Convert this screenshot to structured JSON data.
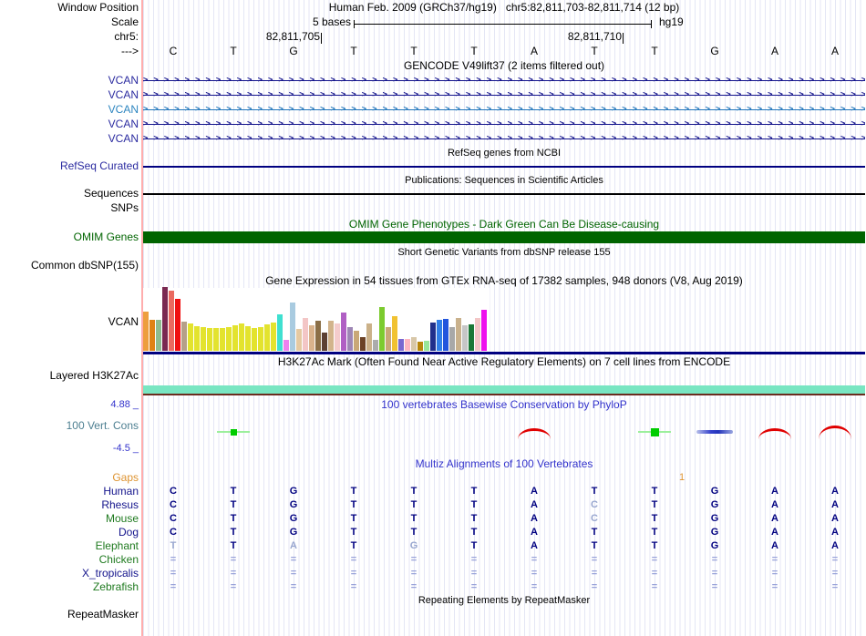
{
  "header": {
    "window_position_label": "Window Position",
    "assembly": "Human Feb. 2009 (GRCh37/hg19)",
    "position": "chr5:82,811,703-82,811,714 (12 bp)",
    "scale_label": "Scale",
    "scale_value": "5 bases",
    "scale_assembly": "hg19",
    "chrom_label": "chr5:",
    "coord_left": "82,811,705",
    "coord_right": "82,811,710",
    "direction_label": "--->"
  },
  "sequence": {
    "bases": [
      "C",
      "T",
      "G",
      "T",
      "T",
      "T",
      "A",
      "T",
      "T",
      "G",
      "A",
      "A"
    ]
  },
  "gencode": {
    "title": "GENCODE V49lift37 (2 items filtered out)",
    "transcripts": [
      {
        "label": "VCAN",
        "color": "#14148c"
      },
      {
        "label": "VCAN",
        "color": "#14148c"
      },
      {
        "label": "VCAN",
        "color": "#2276bb"
      },
      {
        "label": "VCAN",
        "color": "#14148c"
      },
      {
        "label": "VCAN",
        "color": "#14148c"
      }
    ]
  },
  "refseq": {
    "title": "RefSeq genes from NCBI",
    "row_label": "RefSeq Curated",
    "line_color": "#000080"
  },
  "publications": {
    "title": "Publications: Sequences in Scientific Articles",
    "row_label": "Sequences",
    "line_color": "#000000"
  },
  "snps": {
    "row_label": "SNPs"
  },
  "omim": {
    "title": "OMIM Gene Phenotypes - Dark Green Can Be Disease-causing",
    "row_label": "OMIM Genes",
    "bar_color": "#006400"
  },
  "dbsnp": {
    "title": "Short Genetic Variants from dbSNP release 155",
    "row_label": "Common dbSNP(155)"
  },
  "gtex": {
    "title": "Gene Expression in 54 tissues from GTEx RNA-seq of 17382 samples, 948 donors (V8, Aug 2019)",
    "row_label": "VCAN",
    "baseline_color": "#000080",
    "bars": [
      {
        "c": "#ED9E3E",
        "h": 43
      },
      {
        "c": "#E08214",
        "h": 34
      },
      {
        "c": "#8FBC8F",
        "h": 34
      },
      {
        "c": "#7A2951",
        "h": 70
      },
      {
        "c": "#EA6A5F",
        "h": 66
      },
      {
        "c": "#F01010",
        "h": 57
      },
      {
        "c": "#B5A089",
        "h": 32
      },
      {
        "c": "#E3E32E",
        "h": 30
      },
      {
        "c": "#E3E32E",
        "h": 27
      },
      {
        "c": "#E3E32E",
        "h": 26
      },
      {
        "c": "#E3E32E",
        "h": 25
      },
      {
        "c": "#E3E32E",
        "h": 25
      },
      {
        "c": "#E3E32E",
        "h": 25
      },
      {
        "c": "#E3E32E",
        "h": 26
      },
      {
        "c": "#E3E32E",
        "h": 28
      },
      {
        "c": "#E3E32E",
        "h": 30
      },
      {
        "c": "#E3E32E",
        "h": 27
      },
      {
        "c": "#E3E32E",
        "h": 25
      },
      {
        "c": "#E3E32E",
        "h": 26
      },
      {
        "c": "#E3E32E",
        "h": 29
      },
      {
        "c": "#E3E32E",
        "h": 31
      },
      {
        "c": "#3FE0D0",
        "h": 40
      },
      {
        "c": "#EE82EE",
        "h": 12
      },
      {
        "c": "#A9CBE0",
        "h": 53
      },
      {
        "c": "#E5C9A2",
        "h": 24
      },
      {
        "c": "#F3C6C6",
        "h": 36
      },
      {
        "c": "#D9B38C",
        "h": 28
      },
      {
        "c": "#8B6F47",
        "h": 33
      },
      {
        "c": "#5C4033",
        "h": 20
      },
      {
        "c": "#D2B48C",
        "h": 33
      },
      {
        "c": "#F4CCCC",
        "h": 30
      },
      {
        "c": "#B05FC4",
        "h": 42
      },
      {
        "c": "#9E86B5",
        "h": 26
      },
      {
        "c": "#C9A877",
        "h": 22
      },
      {
        "c": "#6B4226",
        "h": 15
      },
      {
        "c": "#CBB189",
        "h": 30
      },
      {
        "c": "#ABABAB",
        "h": 12
      },
      {
        "c": "#7CCB2F",
        "h": 48
      },
      {
        "c": "#C9A877",
        "h": 26
      },
      {
        "c": "#F1C232",
        "h": 38
      },
      {
        "c": "#7A68D0",
        "h": 13
      },
      {
        "c": "#FFB6C1",
        "h": 13
      },
      {
        "c": "#D8C7A8",
        "h": 15
      },
      {
        "c": "#B8860B",
        "h": 10
      },
      {
        "c": "#98E698",
        "h": 11
      },
      {
        "c": "#20308C",
        "h": 31
      },
      {
        "c": "#2F7FE8",
        "h": 34
      },
      {
        "c": "#2255DD",
        "h": 35
      },
      {
        "c": "#A8A8A8",
        "h": 26
      },
      {
        "c": "#C9B18C",
        "h": 36
      },
      {
        "c": "#C6C6C6",
        "h": 28
      },
      {
        "c": "#1B7837",
        "h": 29
      },
      {
        "c": "#F3C6C6",
        "h": 36
      },
      {
        "c": "#EE10EE",
        "h": 45
      }
    ]
  },
  "h3k27ac": {
    "title": "H3K27Ac Mark (Often Found Near Active Regulatory Elements) on 7 cell lines from ENCODE",
    "row_label": "Layered H3K27Ac",
    "band_color": "#79e6c2",
    "underline_color": "#6a2c1e"
  },
  "phylop": {
    "title": "100 vertebrates Basewise Conservation by PhyloP",
    "row_label": "100 Vert. Cons",
    "max_label": "4.88 _",
    "min_label": "-4.5 _",
    "marks": [
      {
        "type": "green",
        "col": 1,
        "size": 7
      },
      {
        "type": "red",
        "col": 6,
        "h": 9
      },
      {
        "type": "green",
        "col": 8,
        "size": 9
      },
      {
        "type": "blue",
        "col": 9
      },
      {
        "type": "red",
        "col": 10,
        "h": 9
      },
      {
        "type": "red",
        "col": 11,
        "h": 12
      }
    ]
  },
  "multiz": {
    "title": "Multiz Alignments of 100 Vertebrates",
    "gaps_label": "Gaps",
    "gap_marker": "1",
    "species": [
      {
        "name": "Human",
        "color": "#14148c",
        "cells": [
          "C",
          "T",
          "G",
          "T",
          "T",
          "T",
          "A",
          "T",
          "T",
          "G",
          "A",
          "A"
        ]
      },
      {
        "name": "Rhesus",
        "color": "#14148c",
        "cells": [
          "C",
          "T",
          "G",
          "T",
          "T",
          "T",
          "A",
          "c",
          "T",
          "G",
          "A",
          "A"
        ]
      },
      {
        "name": "Mouse",
        "color": "#1f7a1f",
        "cells": [
          "C",
          "T",
          "G",
          "T",
          "T",
          "T",
          "A",
          "c",
          "T",
          "G",
          "A",
          "A"
        ]
      },
      {
        "name": "Dog",
        "color": "#14148c",
        "cells": [
          "C",
          "T",
          "G",
          "T",
          "T",
          "T",
          "A",
          "T",
          "T",
          "G",
          "A",
          "A"
        ]
      },
      {
        "name": "Elephant",
        "color": "#1f7a1f",
        "cells": [
          "t",
          "T",
          "a",
          "T",
          "g",
          "T",
          "A",
          "T",
          "T",
          "G",
          "A",
          "A"
        ]
      },
      {
        "name": "Chicken",
        "color": "#1f7a1f",
        "cells": [
          "=",
          "=",
          "=",
          "=",
          "=",
          "=",
          "=",
          "=",
          "=",
          "=",
          "=",
          "="
        ]
      },
      {
        "name": "X_tropicalis",
        "color": "#14148c",
        "cells": [
          "=",
          "=",
          "=",
          "=",
          "=",
          "=",
          "=",
          "=",
          "=",
          "=",
          "=",
          "="
        ]
      },
      {
        "name": "Zebrafish",
        "color": "#1f7a1f",
        "cells": [
          "=",
          "=",
          "=",
          "=",
          "=",
          "=",
          "=",
          "=",
          "=",
          "=",
          "=",
          "="
        ]
      }
    ]
  },
  "repeatmasker": {
    "title": "Repeating Elements by RepeatMasker",
    "row_label": "RepeatMasker"
  }
}
